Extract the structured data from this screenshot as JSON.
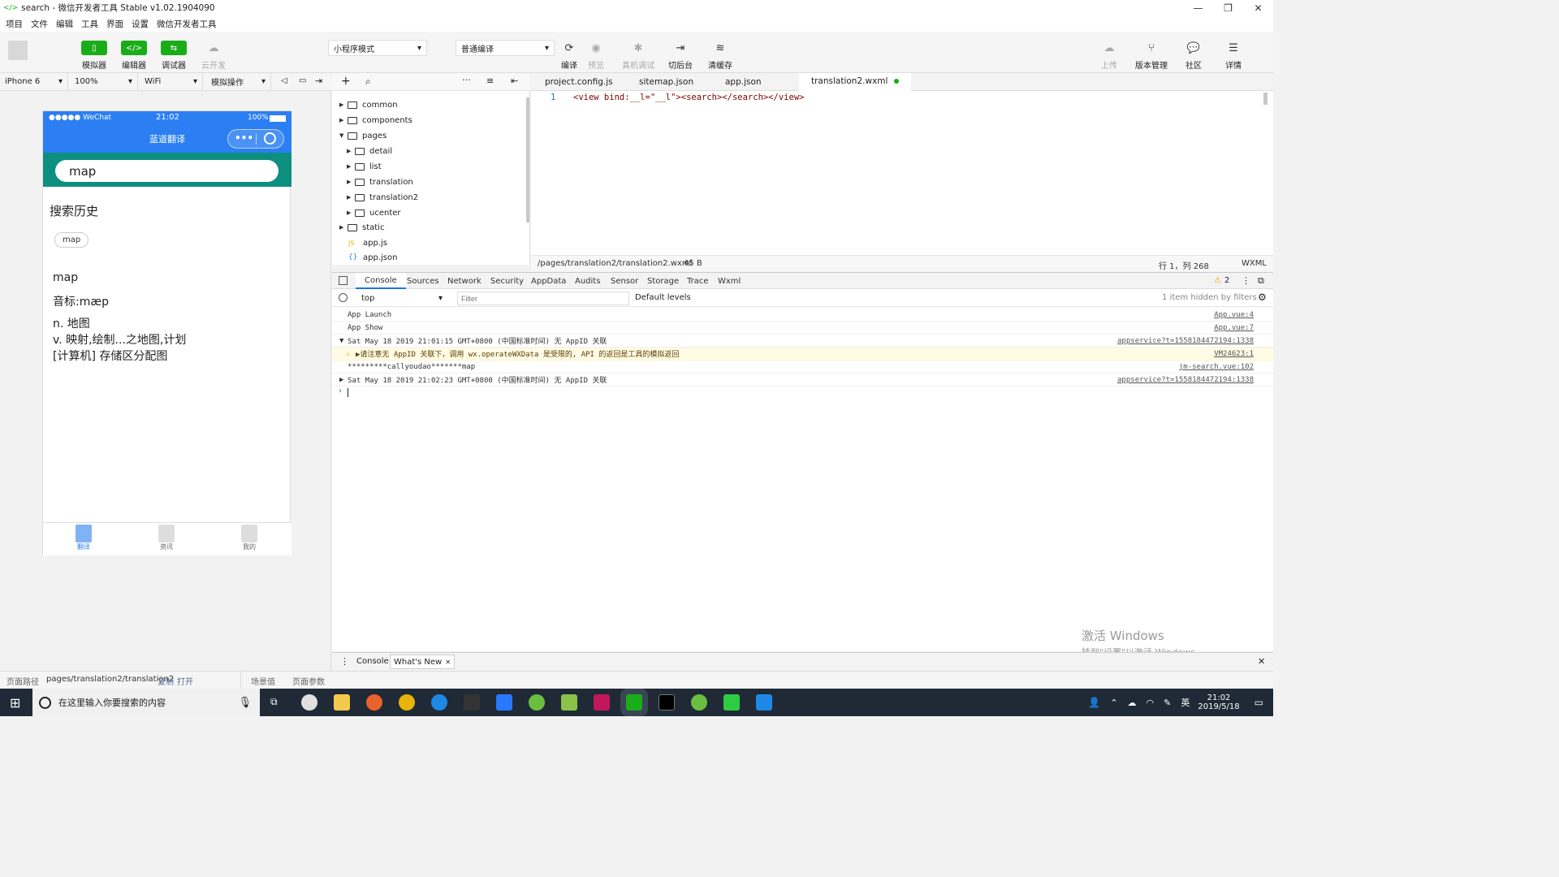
{
  "window": {
    "title": "search - 微信开发者工具 Stable v1.02.1904090",
    "min": "—",
    "max": "❐",
    "close": "✕"
  },
  "menu": [
    "项目",
    "文件",
    "编辑",
    "工具",
    "界面",
    "设置",
    "微信开发者工具"
  ],
  "toolbar": {
    "simulator": "模拟器",
    "editor": "编辑器",
    "debugger": "调试器",
    "cloud": "云开发",
    "mode": "小程序模式",
    "compile_mode": "普通编译",
    "compile": "编译",
    "preview": "预览",
    "remote_debug": "真机调试",
    "background": "切后台",
    "clear_cache": "清缓存",
    "upload": "上传",
    "version": "版本管理",
    "community": "社区",
    "details": "详情"
  },
  "simbar": {
    "device": "iPhone 6",
    "zoom": "100%",
    "network": "WiFi",
    "action": "模拟操作"
  },
  "phone": {
    "status_carrier": "●●●●● WeChat",
    "status_time": "21:02",
    "status_battery": "100%",
    "nav_title": "蓝道翻译",
    "search_value": "map",
    "history_title": "搜索历史",
    "history_tag": "map",
    "word": "map",
    "phonetic": "音标:mæp",
    "def1": "n. 地图",
    "def2": "v. 映射,绘制...之地图,计划",
    "def3": "[计算机] 存储区分配图",
    "tabs": [
      "翻译",
      "资讯",
      "我的"
    ]
  },
  "tree": {
    "items": [
      {
        "name": "common",
        "type": "folder"
      },
      {
        "name": "components",
        "type": "folder"
      },
      {
        "name": "pages",
        "type": "folder-open"
      },
      {
        "name": "detail",
        "type": "folder"
      },
      {
        "name": "list",
        "type": "folder"
      },
      {
        "name": "translation",
        "type": "folder"
      },
      {
        "name": "translation2",
        "type": "folder"
      },
      {
        "name": "ucenter",
        "type": "folder"
      },
      {
        "name": "static",
        "type": "folder"
      },
      {
        "name": "app.js",
        "type": "js"
      },
      {
        "name": "app.json",
        "type": "json"
      }
    ]
  },
  "editor": {
    "tabs": [
      "project.config.js",
      "sitemap.json",
      "app.json",
      "translation2.wxml"
    ],
    "line_no": "1",
    "code": "<view bind:__l=\"__l\"><search></search></view>",
    "path": "/pages/translation2/translation2.wxml",
    "size": "45 B",
    "position": "行 1，列 268",
    "lang": "WXML"
  },
  "devtools": {
    "tabs": [
      "Console",
      "Sources",
      "Network",
      "Security",
      "AppData",
      "Audits",
      "Sensor",
      "Storage",
      "Trace",
      "Wxml"
    ],
    "warn_count": "2",
    "context": "top",
    "filter_placeholder": "Filter",
    "levels": "Default levels",
    "hidden": "1 item hidden by filters",
    "rows": [
      {
        "text": "App Launch",
        "src": "App.vue:4"
      },
      {
        "text": "App Show",
        "src": "App.vue:7"
      },
      {
        "text": "Sat May 18 2019 21:01:15 GMT+0800 (中国标准时间) 无 AppID 关联",
        "src": "appservice?t=1558184472194:1338"
      },
      {
        "text": "▶请注意无 AppID 关联下，调用 wx.operateWXData 是受限的, API 的返回是工具的模拟返回",
        "src": "VM24623:1"
      },
      {
        "text": "*********callyoudao*******map",
        "src": "jm-search.vue:102"
      },
      {
        "text": "Sat May 18 2019 21:02:23 GMT+0800 (中国标准时间) 无 AppID 关联",
        "src": "appservice?t=1558184472194:1338"
      }
    ]
  },
  "drawer": {
    "tab1": "Console",
    "tab2": "What's New"
  },
  "bottom": {
    "path_label": "页面路径",
    "path": "pages/translation2/translation2",
    "copy": "复制",
    "open": "打开",
    "scene": "场景值",
    "params": "页面参数"
  },
  "watermark": {
    "line1": "激活 Windows",
    "line2": "转到\"设置\"以激活 Windows。"
  },
  "taskbar": {
    "search": "在这里输入你要搜索的内容",
    "time": "21:02",
    "date": "2019/5/18",
    "ime": "英"
  }
}
